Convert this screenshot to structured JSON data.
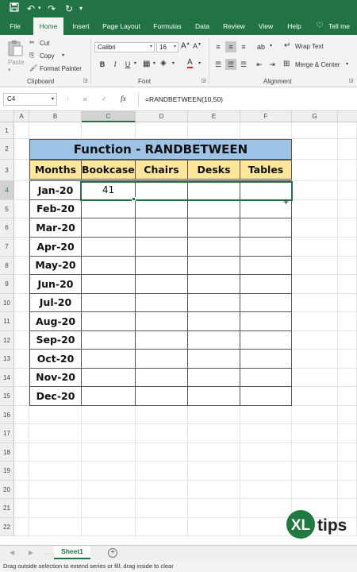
{
  "titlebar": {
    "save_icon": "save-icon",
    "undo_icon": "undo-icon",
    "redo_icon": "redo-icon"
  },
  "tabs": [
    "File",
    "Home",
    "Insert",
    "Page Layout",
    "Formulas",
    "Data",
    "Review",
    "View",
    "Help"
  ],
  "tell_me": "Tell me",
  "ribbon": {
    "paste": "Paste",
    "cut": "Cut",
    "copy": "Copy",
    "format_painter": "Format Painter",
    "clipboard_label": "Clipboard",
    "font_name": "Calibri",
    "font_size": "16",
    "font_label": "Font",
    "bold": "B",
    "italic": "I",
    "underline": "U",
    "wrap_text": "Wrap Text",
    "merge_center": "Merge & Center",
    "alignment_label": "Alignment"
  },
  "formula_bar": {
    "name_box": "C4",
    "cancel": "✕",
    "enter": "✓",
    "fx": "fx",
    "formula": "=RANDBETWEEN(10,50)"
  },
  "grid": {
    "columns": [
      "A",
      "B",
      "C",
      "D",
      "E",
      "F",
      "G"
    ],
    "rows": [
      "1",
      "2",
      "3",
      "4",
      "5",
      "6",
      "7",
      "8",
      "9",
      "10",
      "11",
      "12",
      "13",
      "14",
      "15",
      "16",
      "17",
      "18",
      "19",
      "20",
      "21",
      "22"
    ],
    "active_cell": "C4"
  },
  "table": {
    "title": "Function - RANDBETWEEN",
    "headers": [
      "Months",
      "Bookcases",
      "Chairs",
      "Desks",
      "Tables"
    ],
    "months": [
      "Jan-20",
      "Feb-20",
      "Mar-20",
      "Apr-20",
      "May-20",
      "Jun-20",
      "Jul-20",
      "Aug-20",
      "Sep-20",
      "Oct-20",
      "Nov-20",
      "Dec-20"
    ],
    "bookcases_jan": "41"
  },
  "sheets": {
    "active": "Sheet1",
    "add_label": "+"
  },
  "status": "Drag outside selection to extend series or fill; drag inside to clear",
  "logo": {
    "xl": "XL",
    "tips": "tips"
  },
  "colors": {
    "excel_green": "#217346",
    "title_fill": "#9dc3e6",
    "header_fill": "#ffe699"
  }
}
